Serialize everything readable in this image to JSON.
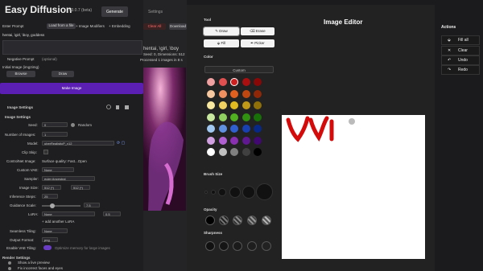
{
  "app": {
    "title": "Easy Diffusion",
    "version": "v3.0.7 (beta)"
  },
  "tabs": [
    "Generate",
    "Settings"
  ],
  "left": {
    "prompt_label": "Enter Prompt",
    "load_file": "Load from a file",
    "prompt_text": "hentai, \\girl, \\boy, goddess",
    "image_modifiers": "+ Image Modifiers",
    "embeddings": "+ Embedding",
    "neg_prompt": "Negative Prompt",
    "optional": "(optional)",
    "initial_image": "Initial Image (img2img)",
    "browse": "Browse",
    "draw": "Draw",
    "make_image": "Make Image",
    "image_settings": "Image Settings",
    "image_settings_sub": "Image Settings",
    "seed_label": "Seed:",
    "seed_val": "0",
    "random": "Random",
    "num_images_label": "Number of Images:",
    "num_images_val": "1",
    "model_label": "Model:",
    "model_val": "uberRealisticP_v12",
    "clip_skip_label": "Clip Skip:",
    "controlnet_label": "ControlNet Image:",
    "controlnet_val": "Surface quality: Fast...Open",
    "custom_vae_label": "Custom VAE:",
    "custom_vae_val": "None",
    "sampler_label": "Sampler:",
    "sampler_val": "euler Ancestral",
    "image_size_label": "Image Size:",
    "image_size_w": "512 (*)",
    "image_size_h": "512 (*)",
    "inference_label": "Inference Steps:",
    "inference_val": "25",
    "guidance_label": "Guidance Scale:",
    "guidance_val": "7.5",
    "lora_label": "LoRA:",
    "lora_val": "None",
    "lora_strength": "0.5",
    "add_lora": "+ add another LoRA",
    "seamless_label": "Seamless Tiling:",
    "seamless_val": "None",
    "output_format_label": "Output Format:",
    "output_format_val": "png",
    "vae_tiling_label": "Enable VAE Tiling:",
    "vae_tiling_note": "Optimize memory for large images",
    "render_settings": "Render Settings",
    "live_preview": "Show a live preview",
    "fix_faces": "Fix incorrect faces and eyes"
  },
  "middle": {
    "clear_all": "Clear All",
    "download": "Download",
    "prompt_echo": "hentai, \\girl, \\boy",
    "seed_info": "Seed: 0, Dimensions: 512",
    "processed": "Processed 1 images in 8 s"
  },
  "editor": {
    "title": "Image Editor",
    "tool_label": "Tool",
    "tools": [
      "Draw",
      "Erase",
      "Fill",
      "Picker"
    ],
    "color_label": "Color",
    "custom_label": "Custom",
    "colors": [
      [
        "#f0a0a0",
        "#e05050",
        "#cc2020",
        "#aa1010",
        "#880808"
      ],
      [
        "#f8c8a0",
        "#f09060",
        "#e06020",
        "#c04810",
        "#902808"
      ],
      [
        "#f8e8a0",
        "#f0d060",
        "#e0b820",
        "#c09818",
        "#907008"
      ],
      [
        "#c8e8a0",
        "#90d060",
        "#50b020",
        "#309010",
        "#187008"
      ],
      [
        "#a0c8f0",
        "#6090e0",
        "#3060d0",
        "#1840b0",
        "#082888"
      ],
      [
        "#d0a0e0",
        "#b060d0",
        "#8830b0",
        "#601890",
        "#400870"
      ],
      [
        "#ffffff",
        "#c0c0c0",
        "#808080",
        "#404040",
        "#000000"
      ]
    ],
    "selected_color": "#cc2020",
    "brush_size_label": "Brush Size",
    "opacity_label": "Opacity",
    "sharpness_label": "Sharpness"
  },
  "actions": {
    "title": "Actions",
    "items": [
      "Fill all",
      "Clear",
      "Undo",
      "Redo"
    ]
  }
}
